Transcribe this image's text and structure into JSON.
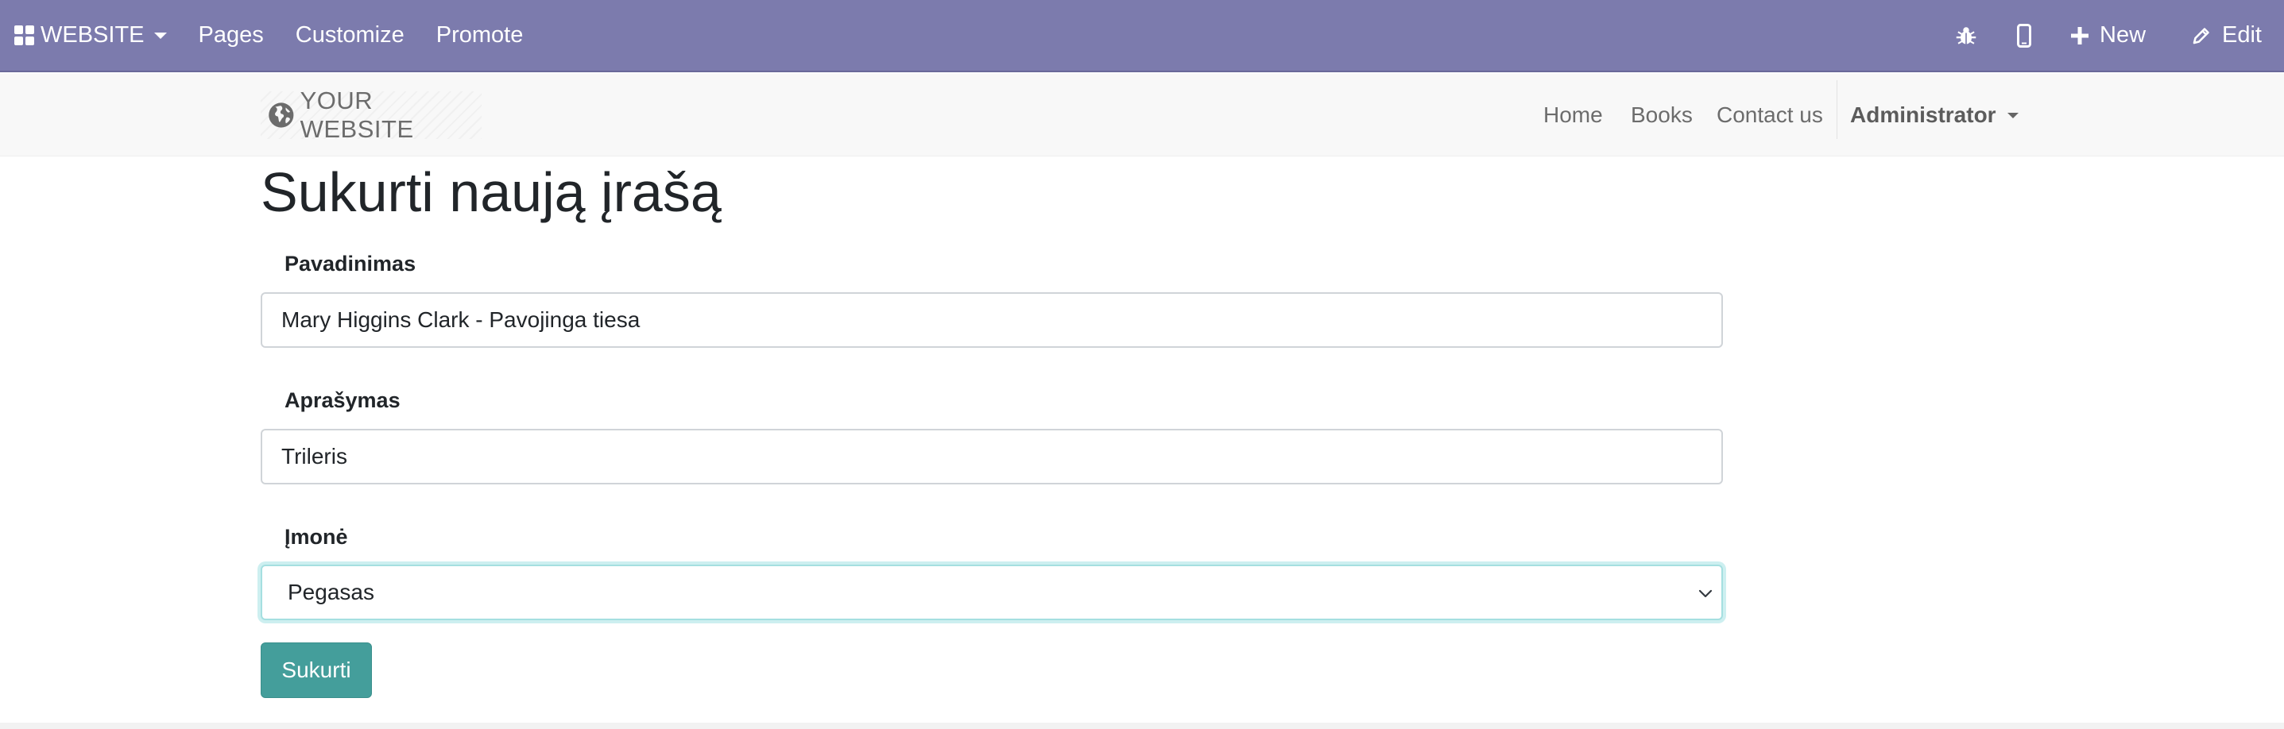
{
  "topbar": {
    "app_label": "WEBSITE",
    "menu": [
      "Pages",
      "Customize",
      "Promote"
    ],
    "new_label": "New",
    "edit_label": "Edit",
    "background_color": "#7c7bad"
  },
  "site_header": {
    "logo_text": "YOUR WEBSITE",
    "nav": [
      "Home",
      "Books",
      "Contact us"
    ],
    "user_label": "Administrator"
  },
  "form": {
    "title": "Sukurti naują įrašą",
    "fields": {
      "name": {
        "label": "Pavadinimas",
        "value": "Mary Higgins Clark - Pavojinga tiesa"
      },
      "description": {
        "label": "Aprašymas",
        "value": "Trileris"
      },
      "company": {
        "label": "Įmonė",
        "selected": "Pegasas"
      }
    },
    "submit_label": "Sukurti",
    "submit_color": "#449e9b"
  }
}
